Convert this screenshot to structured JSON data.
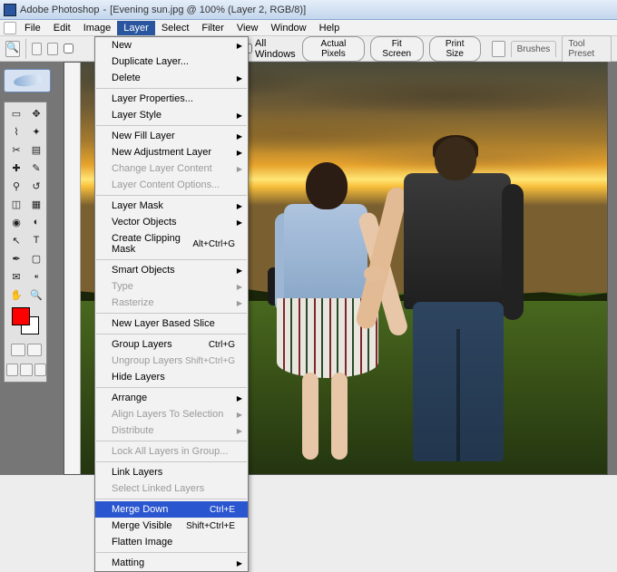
{
  "titlebar": {
    "app": "Adobe Photoshop",
    "doc": "[Evening sun.jpg @ 100% (Layer 2, RGB/8)]"
  },
  "menubar": {
    "sys": "",
    "file": "File",
    "edit": "Edit",
    "image": "Image",
    "layer": "Layer",
    "select": "Select",
    "filter": "Filter",
    "view": "View",
    "window": "Window",
    "help": "Help"
  },
  "options": {
    "all_windows": "All Windows",
    "actual_pixels": "Actual Pixels",
    "fit_screen": "Fit Screen",
    "print_size": "Print Size",
    "brushes": "Brushes",
    "tool_presets": "Tool Preset"
  },
  "layer_menu": {
    "new": "New",
    "duplicate": "Duplicate Layer...",
    "delete": "Delete",
    "properties": "Layer Properties...",
    "style": "Layer Style",
    "new_fill": "New Fill Layer",
    "new_adj": "New Adjustment Layer",
    "change_content": "Change Layer Content",
    "content_opts": "Layer Content Options...",
    "mask": "Layer Mask",
    "vector": "Vector Objects",
    "clip": "Create Clipping Mask",
    "clip_k": "Alt+Ctrl+G",
    "smart": "Smart Objects",
    "type": "Type",
    "raster": "Rasterize",
    "slice": "New Layer Based Slice",
    "group": "Group Layers",
    "group_k": "Ctrl+G",
    "ungroup": "Ungroup Layers",
    "ungroup_k": "Shift+Ctrl+G",
    "hide": "Hide Layers",
    "arrange": "Arrange",
    "align": "Align Layers To Selection",
    "dist": "Distribute",
    "lockall": "Lock All Layers in Group...",
    "link": "Link Layers",
    "sellinked": "Select Linked Layers",
    "merge_down": "Merge Down",
    "merge_down_k": "Ctrl+E",
    "merge_vis": "Merge Visible",
    "merge_vis_k": "Shift+Ctrl+E",
    "flatten": "Flatten Image",
    "matting": "Matting"
  }
}
